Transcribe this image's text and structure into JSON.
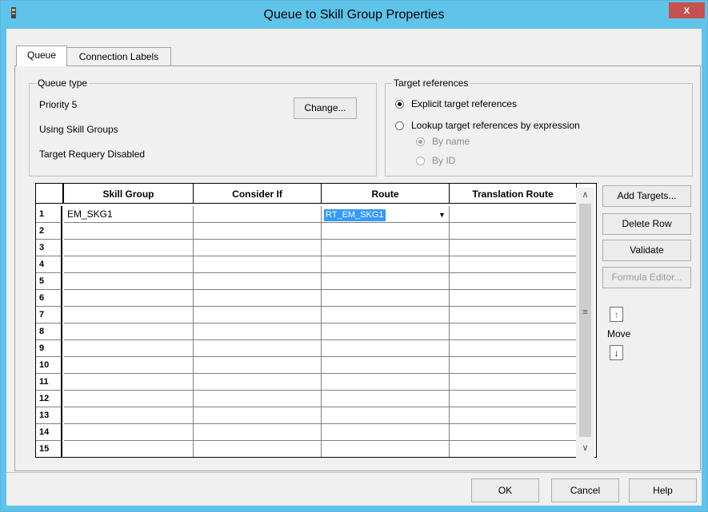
{
  "window": {
    "title": "Queue to Skill Group Properties",
    "close_label": "x",
    "accent_color": "#5fc3ea"
  },
  "tabs": [
    {
      "label": "Queue",
      "active": true
    },
    {
      "label": "Connection Labels",
      "active": false
    }
  ],
  "queue_type": {
    "legend": "Queue type",
    "lines": [
      "Priority 5",
      "Using Skill Groups",
      "Target Requery Disabled"
    ],
    "change_button": "Change..."
  },
  "target_references": {
    "legend": "Target references",
    "options": [
      {
        "label": "Explicit target references",
        "selected": true,
        "enabled": true
      },
      {
        "label": "Lookup target references by expression",
        "selected": false,
        "enabled": true
      }
    ],
    "sub_options": [
      {
        "label": "By name",
        "selected": true,
        "enabled": false
      },
      {
        "label": "By ID",
        "selected": false,
        "enabled": false
      }
    ]
  },
  "grid": {
    "columns": [
      "Skill Group",
      "Consider If",
      "Route",
      "Translation Route"
    ],
    "row_numbers": [
      "1",
      "2",
      "3",
      "4",
      "5",
      "6",
      "7",
      "8",
      "9",
      "10",
      "11",
      "12",
      "13",
      "14",
      "15"
    ],
    "rows": [
      {
        "skill_group": "EM_SKG1",
        "consider_if": "",
        "route": "RT_EM_SKG1",
        "translation_route": ""
      }
    ],
    "scroll_grip": "≡"
  },
  "side_buttons": {
    "add_targets": "Add Targets...",
    "delete_row": "Delete Row",
    "validate": "Validate",
    "formula_editor": "Formula Editor...",
    "move_label": "Move"
  },
  "footer_buttons": {
    "ok": "OK",
    "cancel": "Cancel",
    "help": "Help"
  }
}
